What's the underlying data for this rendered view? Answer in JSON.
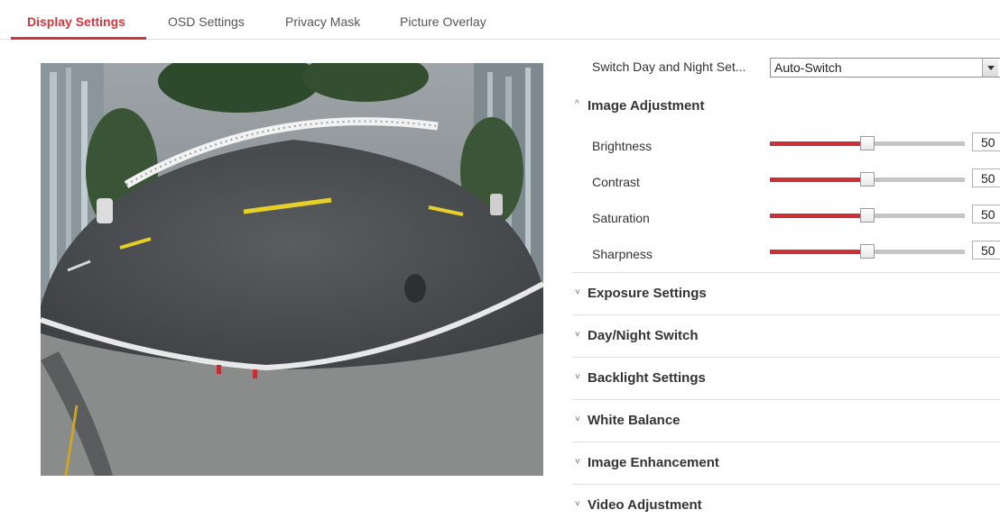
{
  "tabs": [
    {
      "label": "Display Settings",
      "active": true
    },
    {
      "label": "OSD Settings",
      "active": false
    },
    {
      "label": "Privacy Mask",
      "active": false
    },
    {
      "label": "Picture Overlay",
      "active": false
    }
  ],
  "colors": {
    "accent": "#d1373f",
    "slider_fill": "#cf2f36",
    "slider_track": "#c5c5c5"
  },
  "preview": {
    "content": "fisheye-road-camera-view"
  },
  "day_night": {
    "label": "Switch Day and Night Set...",
    "value": "Auto-Switch"
  },
  "image_adjustment": {
    "title": "Image Adjustment",
    "expanded": true,
    "items": [
      {
        "label": "Brightness",
        "value": "50",
        "fraction": 0.5
      },
      {
        "label": "Contrast",
        "value": "50",
        "fraction": 0.5
      },
      {
        "label": "Saturation",
        "value": "50",
        "fraction": 0.5
      },
      {
        "label": "Sharpness",
        "value": "50",
        "fraction": 0.5
      }
    ]
  },
  "sections": [
    {
      "title": "Exposure Settings",
      "expanded": false
    },
    {
      "title": "Day/Night Switch",
      "expanded": false
    },
    {
      "title": "Backlight Settings",
      "expanded": false
    },
    {
      "title": "White Balance",
      "expanded": false
    },
    {
      "title": "Image Enhancement",
      "expanded": false
    },
    {
      "title": "Video Adjustment",
      "expanded": false
    }
  ],
  "icons": {
    "expanded": "chevron-up-icon",
    "collapsed": "chevron-down-icon"
  }
}
